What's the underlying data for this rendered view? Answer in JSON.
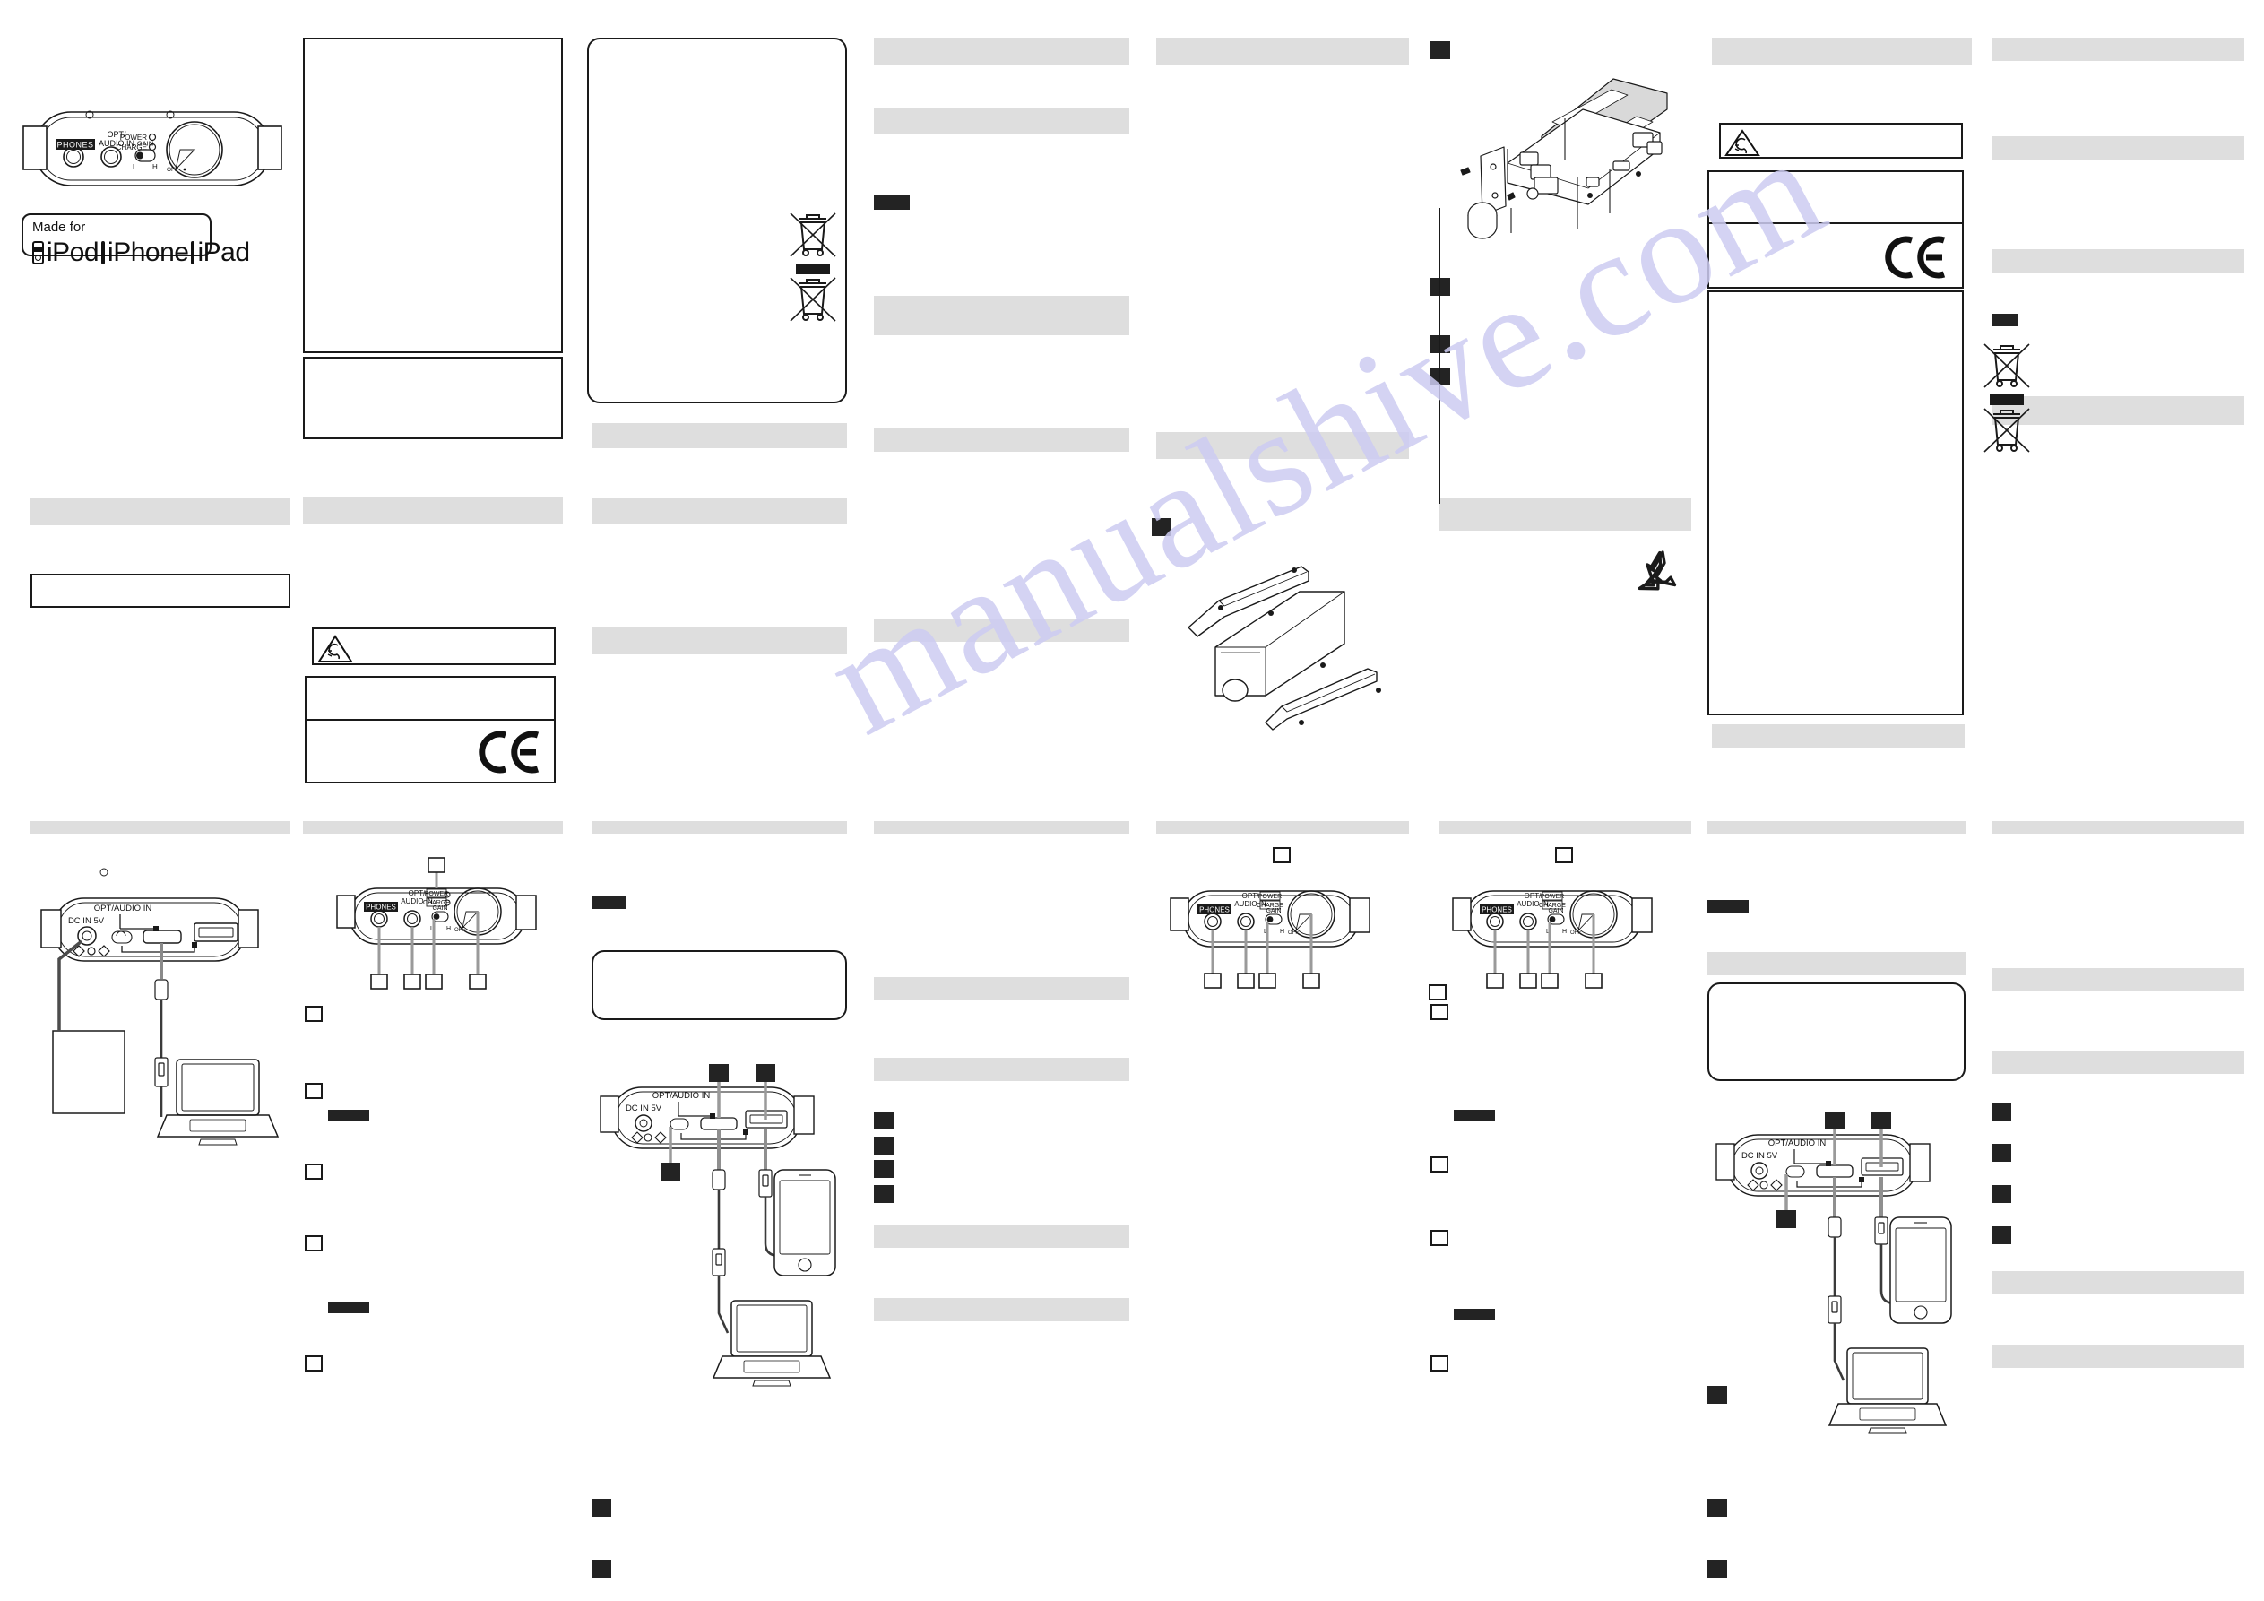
{
  "document": {
    "kind": "multi-language-product-manual-sheet",
    "watermark": "manualshive.com",
    "background_color": "#ffffff",
    "heading_bar_color": "#dedede",
    "redaction_bar_color": "#232323",
    "line_color": "#1a1a1a"
  },
  "device": {
    "front_panel": {
      "phones_label": "PHONES",
      "input_label_line1": "OPT/",
      "input_label_line2": "AUDIO IN",
      "power_label": "POWER",
      "charge_label": "CHARGE",
      "gain_label": "GAIN",
      "gain_low": "L",
      "gain_high": "H",
      "volume_off": "OFF"
    },
    "rear_panel": {
      "dc_label": "DC IN 5V",
      "opt_audio_label": "OPT/AUDIO IN"
    }
  },
  "badges": {
    "made_for": {
      "title": "Made for",
      "items": [
        "iPod",
        "iPhone",
        "iPad"
      ]
    },
    "ce_mark": "CE",
    "recycle_symbol": "mobius-loop",
    "weee_symbol": "crossed-out-wheelie-bin",
    "hearing_warning_symbol": "ear-warning-triangle"
  },
  "columns": [
    {
      "id": "col-1",
      "blocks": [
        {
          "type": "illustration",
          "name": "front-panel-hero"
        },
        {
          "type": "badge",
          "name": "made-for-badge"
        },
        {
          "type": "heading-bar"
        },
        {
          "type": "outline-box"
        },
        {
          "type": "divider"
        },
        {
          "type": "illustration",
          "name": "rear-panel-power-usb-laptop"
        }
      ]
    },
    {
      "id": "col-2",
      "blocks": [
        {
          "type": "outline-box",
          "name": "spec-box-tall"
        },
        {
          "type": "outline-box",
          "name": "spec-box-short"
        },
        {
          "type": "heading-bar"
        },
        {
          "type": "warning-box",
          "name": "hearing-warning"
        },
        {
          "type": "outline-box"
        },
        {
          "type": "ce-box"
        },
        {
          "type": "divider"
        },
        {
          "type": "illustration",
          "name": "front-panel-callouts"
        },
        {
          "type": "callout-squares"
        }
      ]
    },
    {
      "id": "col-3",
      "blocks": [
        {
          "type": "outline-box",
          "name": "spec-box-tall"
        },
        {
          "type": "heading-bar"
        },
        {
          "type": "heading-bar"
        },
        {
          "type": "divider"
        },
        {
          "type": "rounded-box"
        },
        {
          "type": "illustration",
          "name": "rear-panel-usb-iphone-laptop"
        },
        {
          "type": "callout-squares"
        }
      ]
    },
    {
      "id": "col-4",
      "blocks": [
        {
          "type": "heading-bar"
        },
        {
          "type": "weee-symbols"
        },
        {
          "type": "heading-bar"
        },
        {
          "type": "heading-bar"
        },
        {
          "type": "divider"
        },
        {
          "type": "heading-bar"
        },
        {
          "type": "heading-bar"
        },
        {
          "type": "redaction-bars"
        },
        {
          "type": "heading-bar"
        }
      ]
    },
    {
      "id": "col-5",
      "blocks": [
        {
          "type": "heading-bar"
        },
        {
          "type": "heading-bar"
        },
        {
          "type": "illustration",
          "name": "bracket-exploded-view"
        },
        {
          "type": "divider"
        },
        {
          "type": "rounded-box"
        },
        {
          "type": "illustration",
          "name": "rear-panel-power-usb-laptop"
        }
      ]
    },
    {
      "id": "col-6",
      "blocks": [
        {
          "type": "redaction-bars"
        },
        {
          "type": "illustration",
          "name": "internal-exploded-view"
        },
        {
          "type": "heading-bar"
        },
        {
          "type": "divider"
        },
        {
          "type": "illustration",
          "name": "front-panel-callouts"
        },
        {
          "type": "callout-squares"
        }
      ]
    },
    {
      "id": "col-7",
      "blocks": [
        {
          "type": "heading-bar"
        },
        {
          "type": "warning-box",
          "name": "hearing-warning"
        },
        {
          "type": "ce-box"
        },
        {
          "type": "outline-box",
          "name": "tall-notes-box"
        },
        {
          "type": "heading-bar"
        },
        {
          "type": "divider"
        },
        {
          "type": "rounded-box"
        },
        {
          "type": "illustration",
          "name": "rear-panel-usb-iphone-laptop"
        },
        {
          "type": "callout-squares"
        }
      ]
    },
    {
      "id": "col-8",
      "blocks": [
        {
          "type": "heading-bar"
        },
        {
          "type": "heading-bar"
        },
        {
          "type": "heading-bar"
        },
        {
          "type": "redaction-bar"
        },
        {
          "type": "heading-bar"
        },
        {
          "type": "weee-symbols"
        },
        {
          "type": "divider"
        },
        {
          "type": "heading-bar"
        },
        {
          "type": "heading-bar"
        },
        {
          "type": "redaction-bars"
        },
        {
          "type": "heading-bar"
        },
        {
          "type": "heading-bar"
        }
      ]
    }
  ]
}
